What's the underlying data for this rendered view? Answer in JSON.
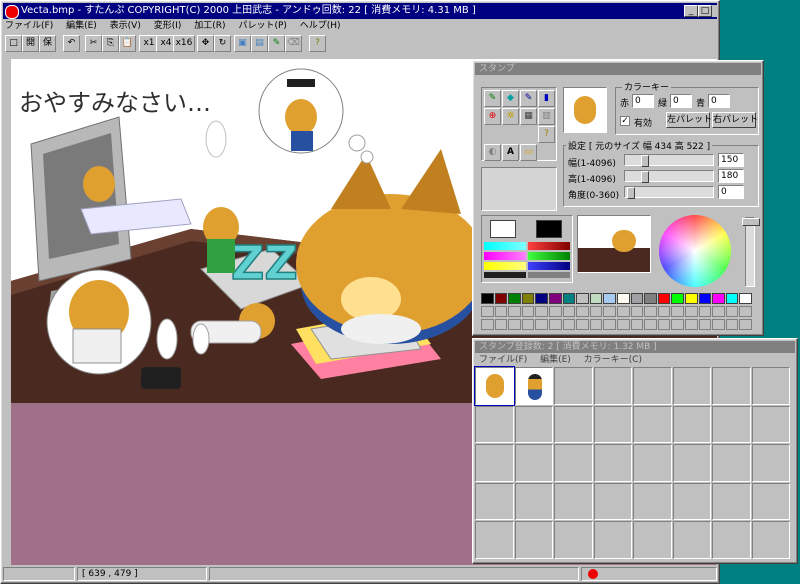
{
  "main_window": {
    "title": "Vecta.bmp - すたんぷ COPYRIGHT(C) 2000 上田武志 - アンドゥ回数: 22 [ 消費メモリ: 4.31 MB ]",
    "menu": [
      "ファイル(F)",
      "編集(E)",
      "表示(V)",
      "変形(I)",
      "加工(R)",
      "パレット(P)",
      "ヘルプ(H)"
    ],
    "toolbar": [
      "□",
      "開",
      "保",
      "↶",
      "✂",
      "⎘",
      "📋",
      "x1",
      "x4",
      "x16",
      "✥",
      "↻",
      "▣",
      "▤",
      "✎",
      "⌫",
      "?"
    ],
    "status": {
      "coords": "[ 639 , 479 ]"
    },
    "canvas": {
      "caption": "おやすみなさい…",
      "bg": "#a07088"
    }
  },
  "stamp_panel": {
    "title": "スタンプ",
    "tools": [
      "✎",
      "◆",
      "✎",
      "▮",
      "⊕",
      "✲",
      "▦",
      "▥",
      "?",
      "◐",
      "A",
      "▭"
    ],
    "color_key": {
      "label": "カラーキー",
      "r_label": "赤",
      "r_value": "0",
      "g_label": "緑",
      "g_value": "0",
      "b_label": "青",
      "b_value": "0",
      "enabled_label": "有効",
      "left_palette": "左パレット",
      "right_palette": "右パレット"
    },
    "settings": {
      "label": "設定 [ 元のサイズ 幅 434 高 522 ]",
      "width_label": "幅(1-4096)",
      "width_value": "150",
      "height_label": "高(1-4096)",
      "height_value": "180",
      "angle_label": "角度(0-360)",
      "angle_value": "0"
    },
    "colors": {
      "primary": "#ffffff",
      "secondary": "#000000",
      "palette": [
        "#000000",
        "#800000",
        "#008000",
        "#808000",
        "#000080",
        "#800080",
        "#008080",
        "#c0c0c0",
        "#c0dcc0",
        "#a6caf0",
        "#fffbf0",
        "#a0a0a4",
        "#808080",
        "#ff0000",
        "#00ff00",
        "#ffff00",
        "#0000ff",
        "#ff00ff",
        "#00ffff",
        "#ffffff"
      ]
    }
  },
  "registry": {
    "title": "スタンプ登録数: 2 [ 消費メモリ: 1.32 MB ]",
    "menu": [
      "ファイル(F)",
      "編集(E)",
      "カラーキー(C)"
    ]
  }
}
